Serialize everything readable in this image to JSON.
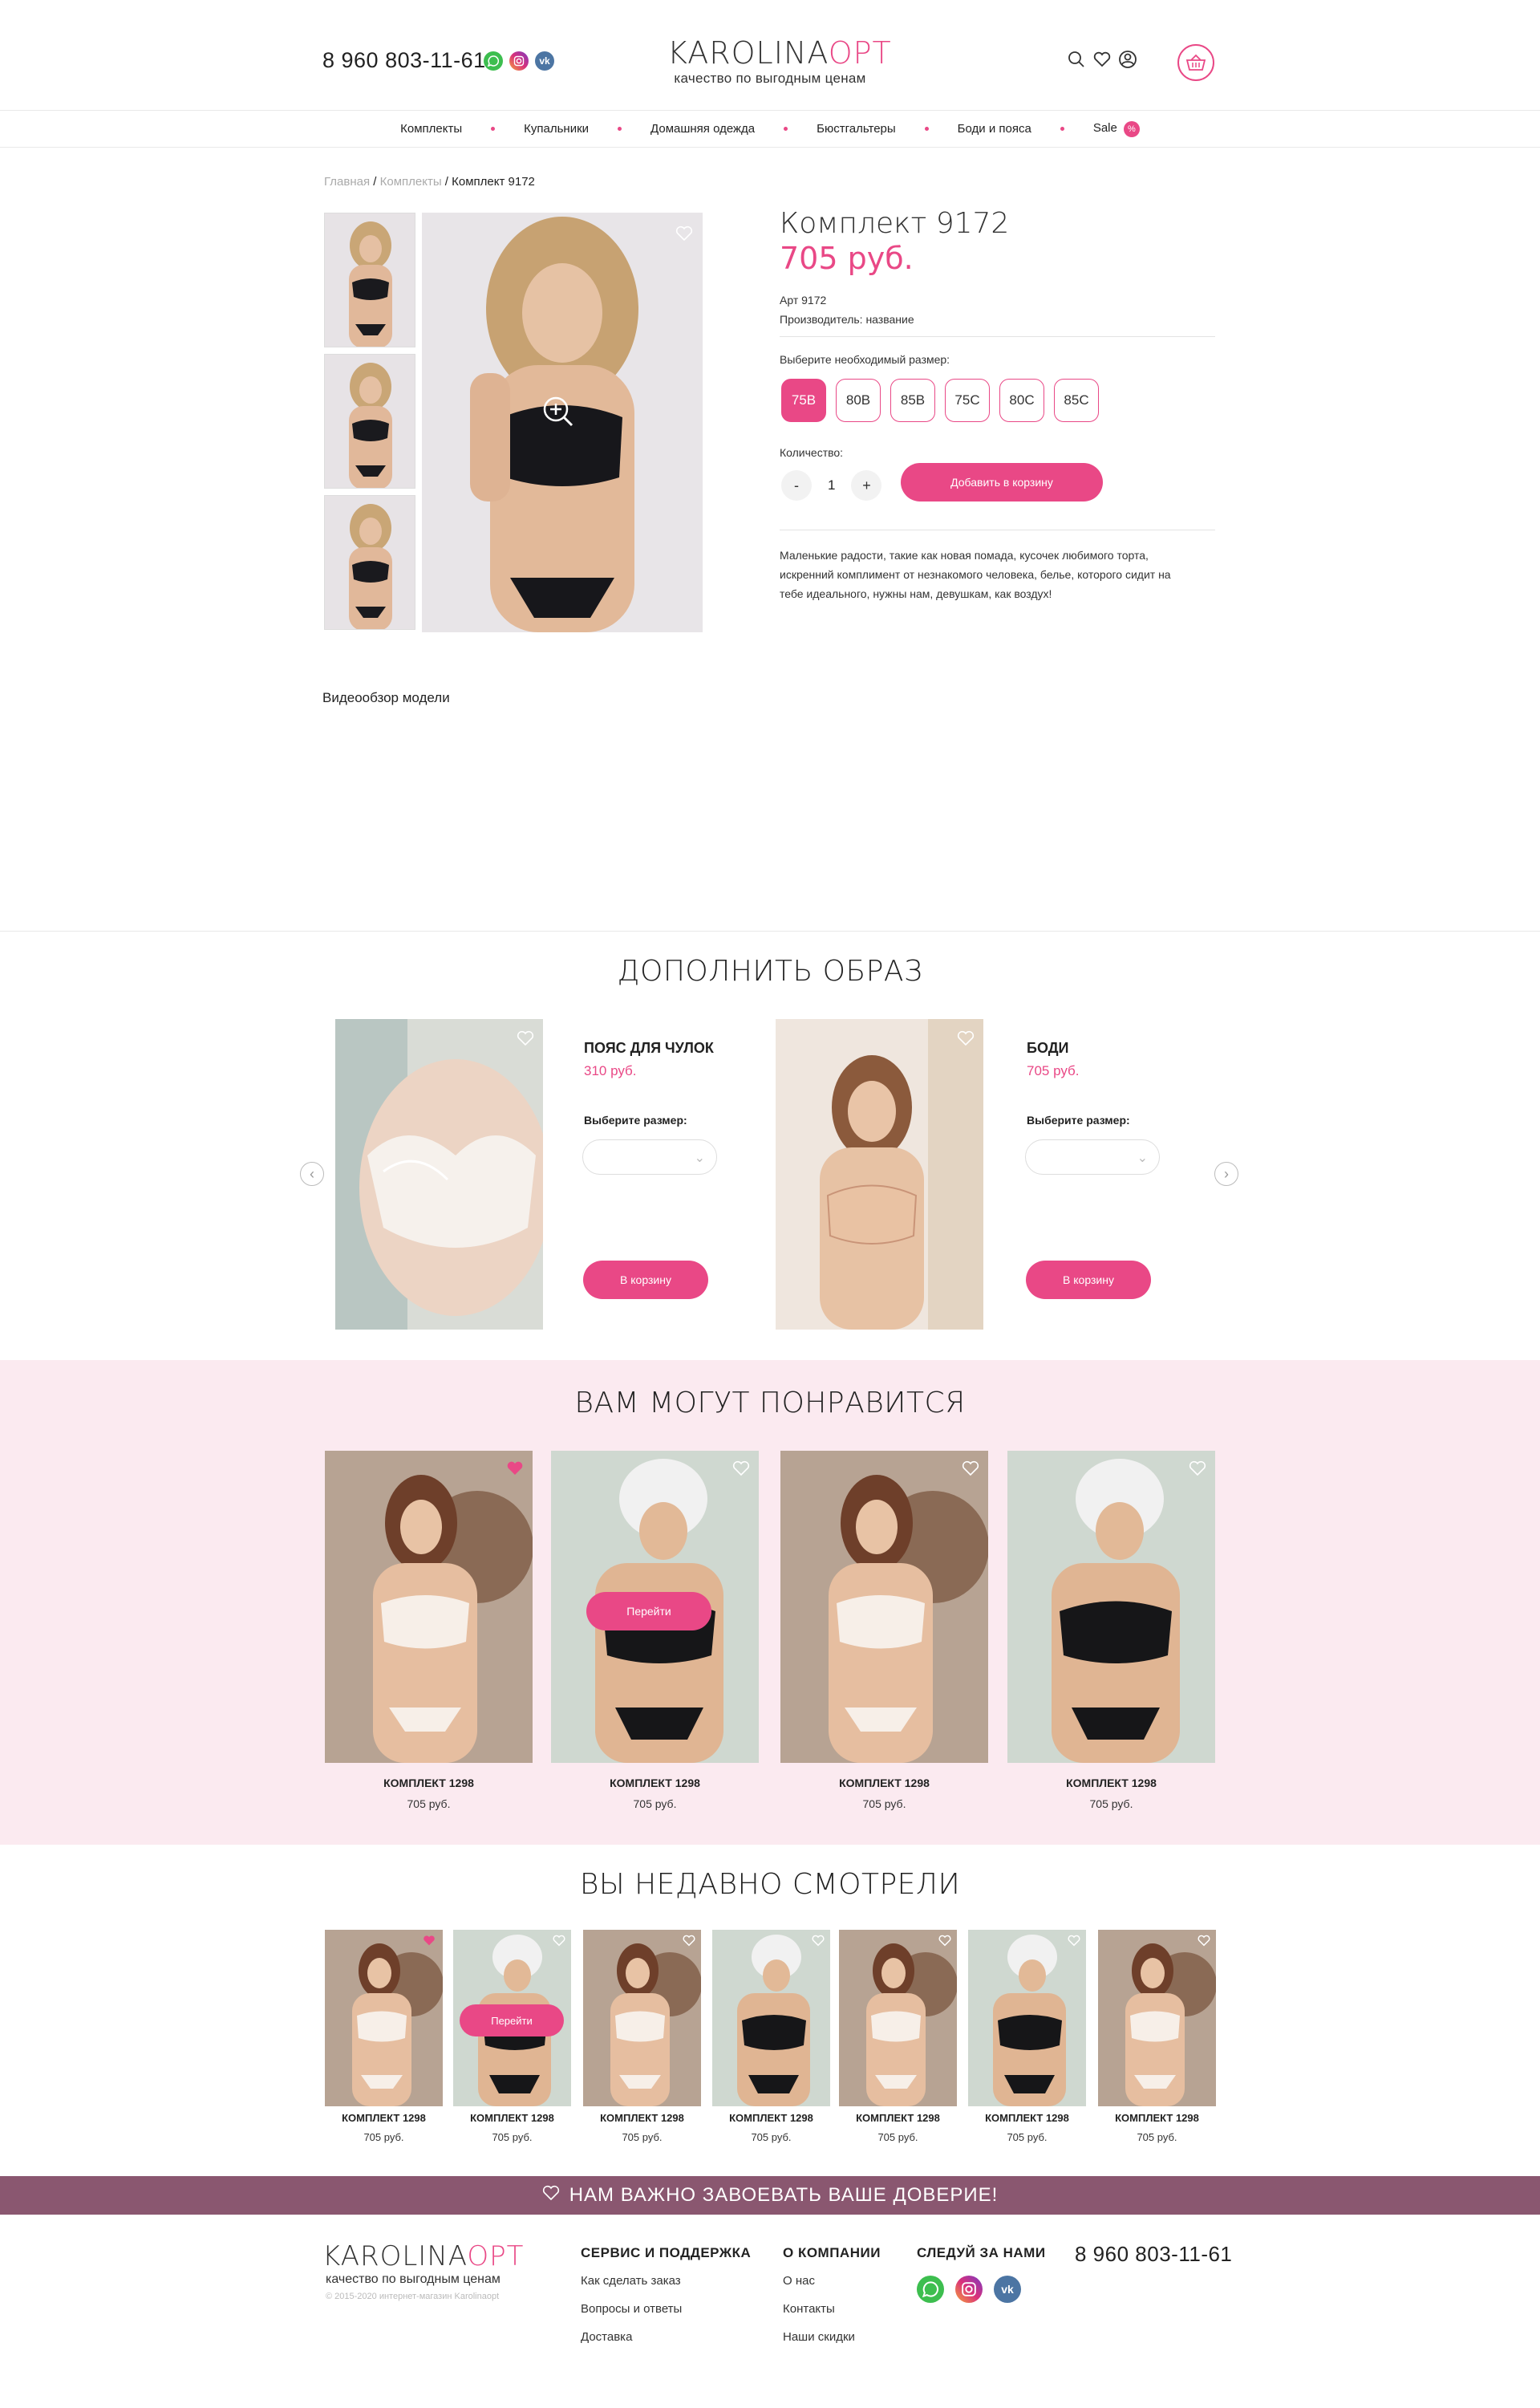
{
  "header": {
    "phone": "8 960 803-11-61",
    "logo_main_left": "KAROLINA",
    "logo_main_right": "OPT",
    "logo_sub": "качество по выгодным ценам",
    "social_icons": [
      "whatsapp-icon",
      "instagram-icon",
      "vk-icon"
    ],
    "icons": [
      "search-icon",
      "heart-icon",
      "user-icon",
      "basket-icon"
    ]
  },
  "nav": {
    "items": [
      "Комплекты",
      "Купальники",
      "Домашняя одежда",
      "Бюстгальтеры",
      "Боди и пояса",
      "Sale"
    ],
    "sale_badge": "%"
  },
  "breadcrumb": {
    "home": "Главная",
    "category": "Комплекты",
    "current": "Комплект 9172"
  },
  "product": {
    "title": "Комплект 9172",
    "price": "705 руб.",
    "article": "Арт 9172",
    "manufacturer": "Производитель: название",
    "size_label": "Выберите необходимый размер:",
    "sizes": [
      "75B",
      "80B",
      "85B",
      "75C",
      "80C",
      "85C"
    ],
    "selected_size": "75B",
    "qty_label": "Количество:",
    "qty_minus": "-",
    "qty_value": "1",
    "qty_plus": "+",
    "add_to_cart": "Добавить в корзину",
    "description": "Маленькие радости, такие как новая помада, кусочек любимого торта, искренний комплимент от незнакомого человека, белье, которого сидит на тебе идеального, нужны нам, девушкам, как воздух!"
  },
  "video": {
    "label": "Видеообзор модели"
  },
  "complement": {
    "title": "ДОПОЛНИТЬ ОБРАЗ",
    "items": [
      {
        "name": "ПОЯС ДЛЯ ЧУЛОК",
        "price": "310 руб.",
        "size_label": "Выберите размер:",
        "button": "В корзину"
      },
      {
        "name": "БОДИ",
        "price": "705 руб.",
        "size_label": "Выберите размер:",
        "button": "В корзину"
      }
    ]
  },
  "recommend": {
    "title": "ВАМ МОГУТ ПОНРАВИТСЯ",
    "go_button": "Перейти",
    "items": [
      {
        "name": "КОМПЛЕКТ 1298",
        "price": "705 руб."
      },
      {
        "name": "КОМПЛЕКТ 1298",
        "price": "705 руб."
      },
      {
        "name": "КОМПЛЕКТ 1298",
        "price": "705 руб."
      },
      {
        "name": "КОМПЛЕКТ 1298",
        "price": "705 руб."
      }
    ]
  },
  "recent": {
    "title": "ВЫ НЕДАВНО СМОТРЕЛИ",
    "go_button": "Перейти",
    "items": [
      {
        "name": "КОМПЛЕКТ 1298",
        "price": "705 руб."
      },
      {
        "name": "КОМПЛЕКТ 1298",
        "price": "705 руб."
      },
      {
        "name": "КОМПЛЕКТ 1298",
        "price": "705 руб."
      },
      {
        "name": "КОМПЛЕКТ 1298",
        "price": "705 руб."
      },
      {
        "name": "КОМПЛЕКТ 1298",
        "price": "705 руб."
      },
      {
        "name": "КОМПЛЕКТ 1298",
        "price": "705 руб."
      },
      {
        "name": "КОМПЛЕКТ 1298",
        "price": "705 руб."
      }
    ]
  },
  "trust_banner": "НАМ ВАЖНО ЗАВОЕВАТЬ ВАШЕ ДОВЕРИЕ!",
  "footer": {
    "logo_left": "KAROLINA",
    "logo_right": "OPT",
    "logo_sub": "качество по выгодным ценам",
    "copyright": "© 2015-2020 интернет-магазин Karolinaopt",
    "service_title": "СЕРВИС И ПОДДЕРЖКА",
    "service_links": [
      "Как сделать заказ",
      "Вопросы и ответы",
      "Доставка"
    ],
    "about_title": "О КОМПАНИИ",
    "about_links": [
      "О нас",
      "Контакты",
      "Наши скидки"
    ],
    "follow_title": "СЛЕДУЙ ЗА НАМИ",
    "phone": "8 960 803-11-61"
  },
  "colors": {
    "accent": "#e94886",
    "banner": "#8a5770",
    "pink_bg": "#fbeaf0"
  }
}
